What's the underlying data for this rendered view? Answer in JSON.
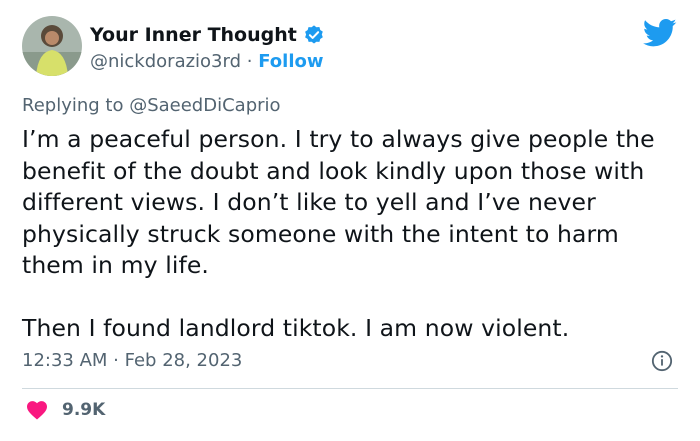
{
  "author": {
    "display_name": "Your Inner Thought",
    "handle": "@nickdorazio3rd",
    "separator": "·",
    "follow_label": "Follow"
  },
  "reply": {
    "prefix": "Replying to ",
    "mention": "@SaeedDiCaprio"
  },
  "tweet": {
    "paragraph1": "I’m a peaceful person. I try to always give people the benefit of the doubt and look kindly upon those with different views. I don’t like to yell and I’ve never physically struck someone with the intent to harm them in my life.",
    "paragraph2": "Then I found landlord tiktok. I am now violent.",
    "timestamp": "12:33 AM · Feb 28, 2023",
    "likes": "9.9K"
  },
  "icons": {
    "verified": "verified-badge-icon",
    "brand": "twitter-bird-icon",
    "info": "info-icon",
    "like": "heart-icon"
  },
  "colors": {
    "accent": "#1d9bf0",
    "like": "#f91880",
    "secondary_text": "#536471"
  }
}
